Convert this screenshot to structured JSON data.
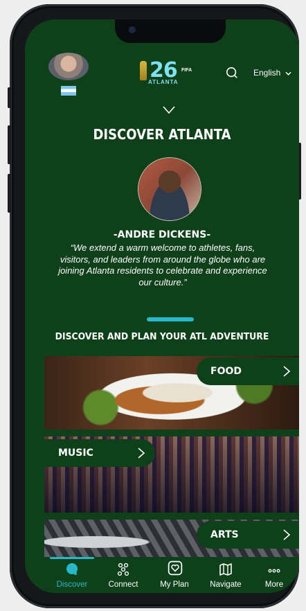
{
  "header": {
    "language": "English",
    "logo": {
      "number": "26",
      "org": "FIFA",
      "city": "ATLANTA"
    }
  },
  "page": {
    "title": "DISCOVER ATLANTA",
    "mayor_name": "-ANDRE DICKENS-",
    "quote": "“We extend a warm welcome to athletes, fans, visitors, and leaders from around the globe who are joining Atlanta residents to celebrate and experience our culture.”",
    "section_title": "DISCOVER AND PLAN YOUR ATL ADVENTURE"
  },
  "categories": [
    {
      "label": "FOOD"
    },
    {
      "label": "MUSIC"
    },
    {
      "label": "ARTS"
    }
  ],
  "nav": {
    "active": "Discover",
    "items": [
      {
        "label": "Discover",
        "icon": "discover-icon"
      },
      {
        "label": "Connect",
        "icon": "connect-icon"
      },
      {
        "label": "My Plan",
        "icon": "my-plan-icon"
      },
      {
        "label": "Navigate",
        "icon": "map-icon"
      },
      {
        "label": "More",
        "icon": "more-icon"
      }
    ]
  },
  "colors": {
    "background": "#0e4019",
    "accent": "#27b9c9",
    "text": "#ffffff"
  }
}
